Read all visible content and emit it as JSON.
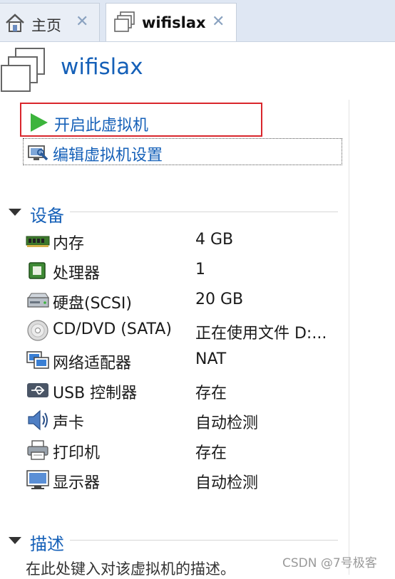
{
  "tabs": [
    {
      "label": "主页",
      "icon": "home-icon"
    },
    {
      "label": "wifislax",
      "icon": "vm-icon"
    }
  ],
  "tab_close_glyph": "✕",
  "vm": {
    "title": "wifislax"
  },
  "commands": {
    "start": "开启此虚拟机",
    "edit": "编辑虚拟机设置"
  },
  "sections": {
    "devices": "设备",
    "description": "描述"
  },
  "devices": [
    {
      "name": "内存",
      "value": "4 GB",
      "icon": "memory-icon"
    },
    {
      "name": "处理器",
      "value": "1",
      "icon": "processor-icon"
    },
    {
      "name": "硬盘(SCSI)",
      "value": "20 GB",
      "icon": "hard-disk-icon"
    },
    {
      "name": "CD/DVD (SATA)",
      "value": "正在使用文件 D:...",
      "icon": "cd-dvd-icon"
    },
    {
      "name": "网络适配器",
      "value": "NAT",
      "icon": "network-adapter-icon"
    },
    {
      "name": "USB 控制器",
      "value": "存在",
      "icon": "usb-icon"
    },
    {
      "name": "声卡",
      "value": "自动检测",
      "icon": "sound-card-icon"
    },
    {
      "name": "打印机",
      "value": "存在",
      "icon": "printer-icon"
    },
    {
      "name": "显示器",
      "value": "自动检测",
      "icon": "display-icon"
    }
  ],
  "description_placeholder": "在此处键入对该虚拟机的描述。",
  "watermark": "CSDN @7号极客",
  "colors": {
    "accent": "#1560b8",
    "highlight_border": "#d9262c",
    "play": "#3cb43c"
  }
}
